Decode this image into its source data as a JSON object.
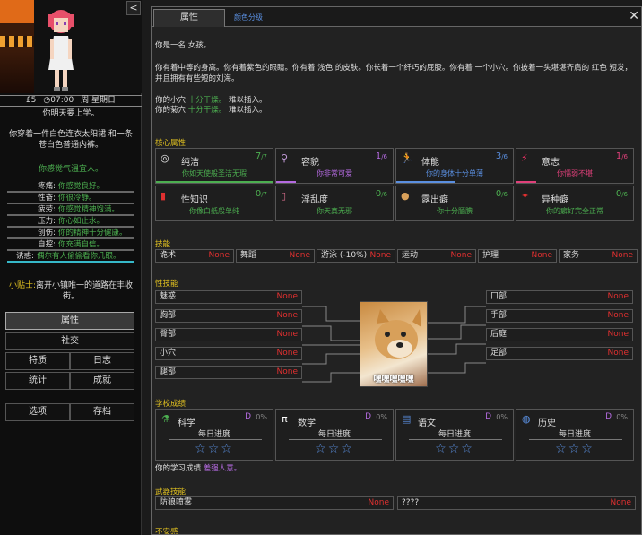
{
  "sidebar": {
    "collapse": "<",
    "status": {
      "money": "£5",
      "time": "07:00",
      "day": "周 星期日"
    },
    "line1": "你明天要上学。",
    "line2": "你穿着一件白色连衣太阳裙 和一条苍白色普通内裤。",
    "line3": "你感觉气温宜人。",
    "stats": [
      {
        "label": "疼痛:",
        "value": "你感觉良好。"
      },
      {
        "label": "性奋:",
        "value": "你很冷静。"
      },
      {
        "label": "疲劳:",
        "value": "你感觉精神饱满。"
      },
      {
        "label": "压力:",
        "value": "你心如止水。"
      },
      {
        "label": "创伤:",
        "value": "你的精神十分健康。"
      },
      {
        "label": "自控:",
        "value": "你充满自信。"
      },
      {
        "label": "诱惑:",
        "value": "偶尔有人偷偷看你几眼。"
      }
    ],
    "tip_label": "小贴士:",
    "tip_text": "离开小镇唯一的道路在丰收街。",
    "nav": {
      "attr": "属性",
      "social": "社交",
      "traits": "特质",
      "journal": "日志",
      "stats": "统计",
      "achievements": "成就",
      "options": "选项",
      "save": "存档"
    }
  },
  "main": {
    "tabs": [
      "属性",
      "颜色分级"
    ],
    "close": "✕",
    "desc": [
      "你是一名 女孩。",
      "你有着中等的身高。你有着紫色的眼睛。你有着 浅色 的皮肤。你长着一个纤巧的屁股。你有着 一个小穴。你披着一头堪堪齐肩的 红色 短发，并且拥有有些短的刘海。",
      "你的小穴",
      "十分干燥。",
      "难以插入。",
      "你的菊穴",
      "十分干燥。",
      "难以插入。"
    ],
    "core_header": "核心属性",
    "core": [
      {
        "name": "纯洁",
        "count": "7",
        "max": "/7",
        "desc": "你如天使般圣洁无瑕",
        "icon": "halo-icon",
        "color": "#4caf50",
        "fill": 1.0
      },
      {
        "name": "容貌",
        "count": "1",
        "max": "/6",
        "desc": "你非常可爱",
        "icon": "mirror-icon",
        "color": "#b46ae0",
        "fill": 0.17
      },
      {
        "name": "体能",
        "count": "3",
        "max": "/6",
        "desc": "你的身体十分单薄",
        "icon": "runner-icon",
        "color": "#5a8fe0",
        "fill": 0.5
      },
      {
        "name": "意志",
        "count": "1",
        "max": "/6",
        "desc": "你懦弱不堪",
        "icon": "feather-icon",
        "color": "#e0407a",
        "fill": 0.17
      },
      {
        "name": "性知识",
        "count": "0",
        "max": "/7",
        "desc": "你像白纸般单纯",
        "icon": "book-icon",
        "color": "#4caf50",
        "fill": 0
      },
      {
        "name": "淫乱度",
        "count": "0",
        "max": "/6",
        "desc": "你天真无邪",
        "icon": "bottle-icon",
        "color": "#4caf50",
        "fill": 0
      },
      {
        "name": "露出癖",
        "count": "0",
        "max": "/6",
        "desc": "你十分腼腆",
        "icon": "dog-icon",
        "color": "#4caf50",
        "fill": 0
      },
      {
        "name": "异种癖",
        "count": "0",
        "max": "/6",
        "desc": "你的癖好完全正常",
        "icon": "paw-icon",
        "color": "#4caf50",
        "fill": 0
      }
    ],
    "skills_header": "技能",
    "skills": [
      {
        "name": "诡术",
        "value": "None"
      },
      {
        "name": "舞蹈",
        "value": "None"
      },
      {
        "name": "游泳 (-10%)",
        "value": "None"
      },
      {
        "name": "运动",
        "value": "None"
      },
      {
        "name": "护理",
        "value": "None"
      },
      {
        "name": "家务",
        "value": "None"
      }
    ],
    "sex_header": "性技能",
    "sex_left": [
      {
        "name": "魅惑",
        "value": "None"
      },
      {
        "name": "胸部",
        "value": "None"
      },
      {
        "name": "臀部",
        "value": "None"
      },
      {
        "name": "小穴",
        "value": "None"
      },
      {
        "name": "腿部",
        "value": "None"
      }
    ],
    "sex_right": [
      {
        "name": "口部",
        "value": "None"
      },
      {
        "name": "手部",
        "value": "None"
      },
      {
        "name": "后庭",
        "value": "None"
      },
      {
        "name": "足部",
        "value": "None"
      }
    ],
    "doge_caption": "嘿嘿嘿嘿嘿",
    "school_header": "学校成绩",
    "subjects": [
      {
        "name": "科学",
        "grade": "D",
        "pct": "0%",
        "progress": "每日进度",
        "stars": "☆☆☆",
        "icon": "flask-icon"
      },
      {
        "name": "数学",
        "grade": "D",
        "pct": "0%",
        "progress": "每日进度",
        "stars": "☆☆☆",
        "icon": "pi-icon"
      },
      {
        "name": "语文",
        "grade": "D",
        "pct": "0%",
        "progress": "每日进度",
        "stars": "☆☆☆",
        "icon": "flag-icon"
      },
      {
        "name": "历史",
        "grade": "D",
        "pct": "0%",
        "progress": "每日进度",
        "stars": "☆☆☆",
        "icon": "globe-icon"
      }
    ],
    "school_note_a": "你的学习成绩",
    "school_note_b": "差强人意。",
    "weapon_header": "武器技能",
    "weapons": [
      {
        "name": "防狼喷雾",
        "value": "None"
      },
      {
        "name": "????",
        "value": "None"
      }
    ],
    "bottom_header": "不安感"
  },
  "colors": {
    "green": "#4caf50",
    "red": "#e03030",
    "yellow": "#e0c020",
    "purple": "#b46ae0",
    "blue": "#5a8fe0"
  }
}
